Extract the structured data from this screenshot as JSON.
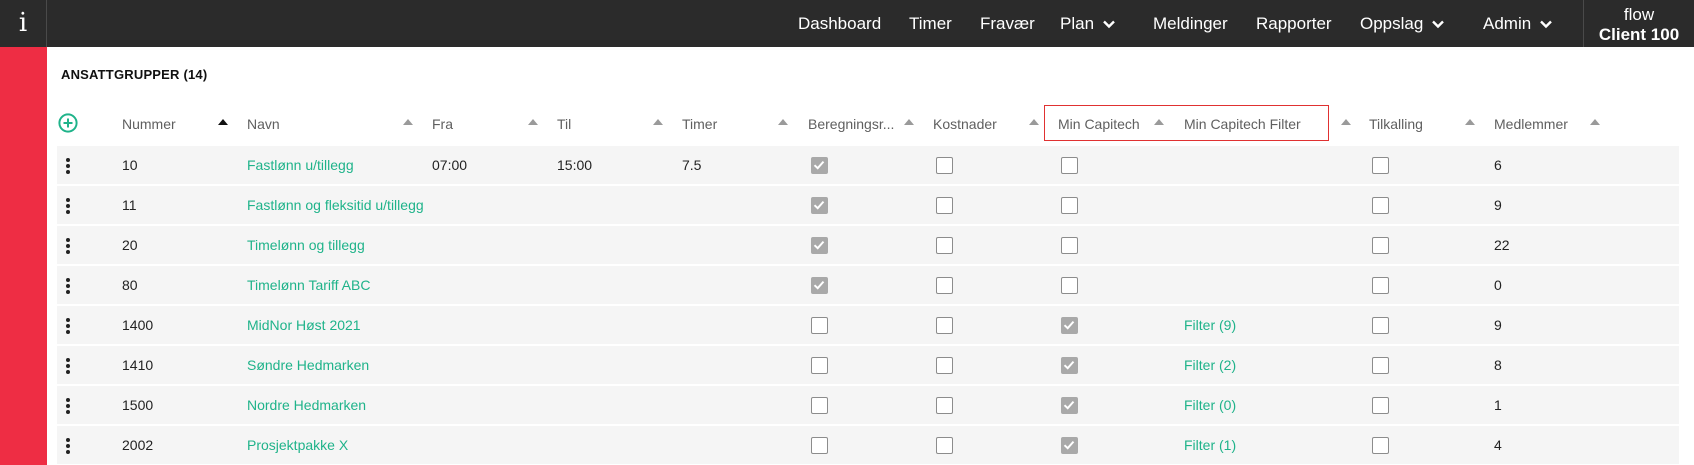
{
  "app": {
    "info_icon_glyph": "i",
    "brand": "flow",
    "client": "Client 100"
  },
  "nav": [
    {
      "label": "Dashboard",
      "dropdown": false
    },
    {
      "label": "Timer",
      "dropdown": false
    },
    {
      "label": "Fravær",
      "dropdown": false
    },
    {
      "label": "Plan",
      "dropdown": true
    },
    {
      "label": "Meldinger",
      "dropdown": false
    },
    {
      "label": "Rapporter",
      "dropdown": false
    },
    {
      "label": "Oppslag",
      "dropdown": true
    },
    {
      "label": "Admin",
      "dropdown": true
    }
  ],
  "section": {
    "title": "ANSATTGRUPPER (14)"
  },
  "columns": {
    "nummer": "Nummer",
    "navn": "Navn",
    "fra": "Fra",
    "til": "Til",
    "timer": "Timer",
    "beregning": "Beregningsr...",
    "kostnader": "Kostnader",
    "min_capitech": "Min Capitech",
    "min_capitech_filter": "Min Capitech Filter",
    "tilkalling": "Tilkalling",
    "medlemmer": "Medlemmer"
  },
  "sort": {
    "column": "nummer",
    "direction": "ascending"
  },
  "rows": [
    {
      "nummer": "10",
      "navn": "Fastlønn u/tillegg",
      "fra": "07:00",
      "til": "15:00",
      "timer": "7.5",
      "beregning": true,
      "kostnader": false,
      "min_capitech": false,
      "filter": "",
      "tilkalling": false,
      "medlemmer": "6"
    },
    {
      "nummer": "11",
      "navn": "Fastlønn og fleksitid u/tillegg",
      "fra": "",
      "til": "",
      "timer": "",
      "beregning": true,
      "kostnader": false,
      "min_capitech": false,
      "filter": "",
      "tilkalling": false,
      "medlemmer": "9"
    },
    {
      "nummer": "20",
      "navn": "Timelønn og tillegg",
      "fra": "",
      "til": "",
      "timer": "",
      "beregning": true,
      "kostnader": false,
      "min_capitech": false,
      "filter": "",
      "tilkalling": false,
      "medlemmer": "22"
    },
    {
      "nummer": "80",
      "navn": "Timelønn Tariff ABC",
      "fra": "",
      "til": "",
      "timer": "",
      "beregning": true,
      "kostnader": false,
      "min_capitech": false,
      "filter": "",
      "tilkalling": false,
      "medlemmer": "0"
    },
    {
      "nummer": "1400",
      "navn": "MidNor Høst 2021",
      "fra": "",
      "til": "",
      "timer": "",
      "beregning": false,
      "kostnader": false,
      "min_capitech": true,
      "filter": "Filter (9)",
      "tilkalling": false,
      "medlemmer": "9"
    },
    {
      "nummer": "1410",
      "navn": "Søndre Hedmarken",
      "fra": "",
      "til": "",
      "timer": "",
      "beregning": false,
      "kostnader": false,
      "min_capitech": true,
      "filter": "Filter (2)",
      "tilkalling": false,
      "medlemmer": "8"
    },
    {
      "nummer": "1500",
      "navn": "Nordre Hedmarken",
      "fra": "",
      "til": "",
      "timer": "",
      "beregning": false,
      "kostnader": false,
      "min_capitech": true,
      "filter": "Filter (0)",
      "tilkalling": false,
      "medlemmer": "1"
    },
    {
      "nummer": "2002",
      "navn": "Prosjektpakke X",
      "fra": "",
      "til": "",
      "timer": "",
      "beregning": false,
      "kostnader": false,
      "min_capitech": true,
      "filter": "Filter (1)",
      "tilkalling": false,
      "medlemmer": "4"
    }
  ],
  "colors": {
    "topbar": "#2b2b2b",
    "sidebar": "#ee2d44",
    "link": "#1fb38a",
    "row": "#f5f5f5",
    "highlight": "#e03131"
  },
  "icons": {
    "add": "plus-circle-icon",
    "row_menu": "kebab-menu-icon",
    "dropdown": "chevron-down-icon",
    "sort": "sort-arrow-icon",
    "info": "info-icon"
  }
}
